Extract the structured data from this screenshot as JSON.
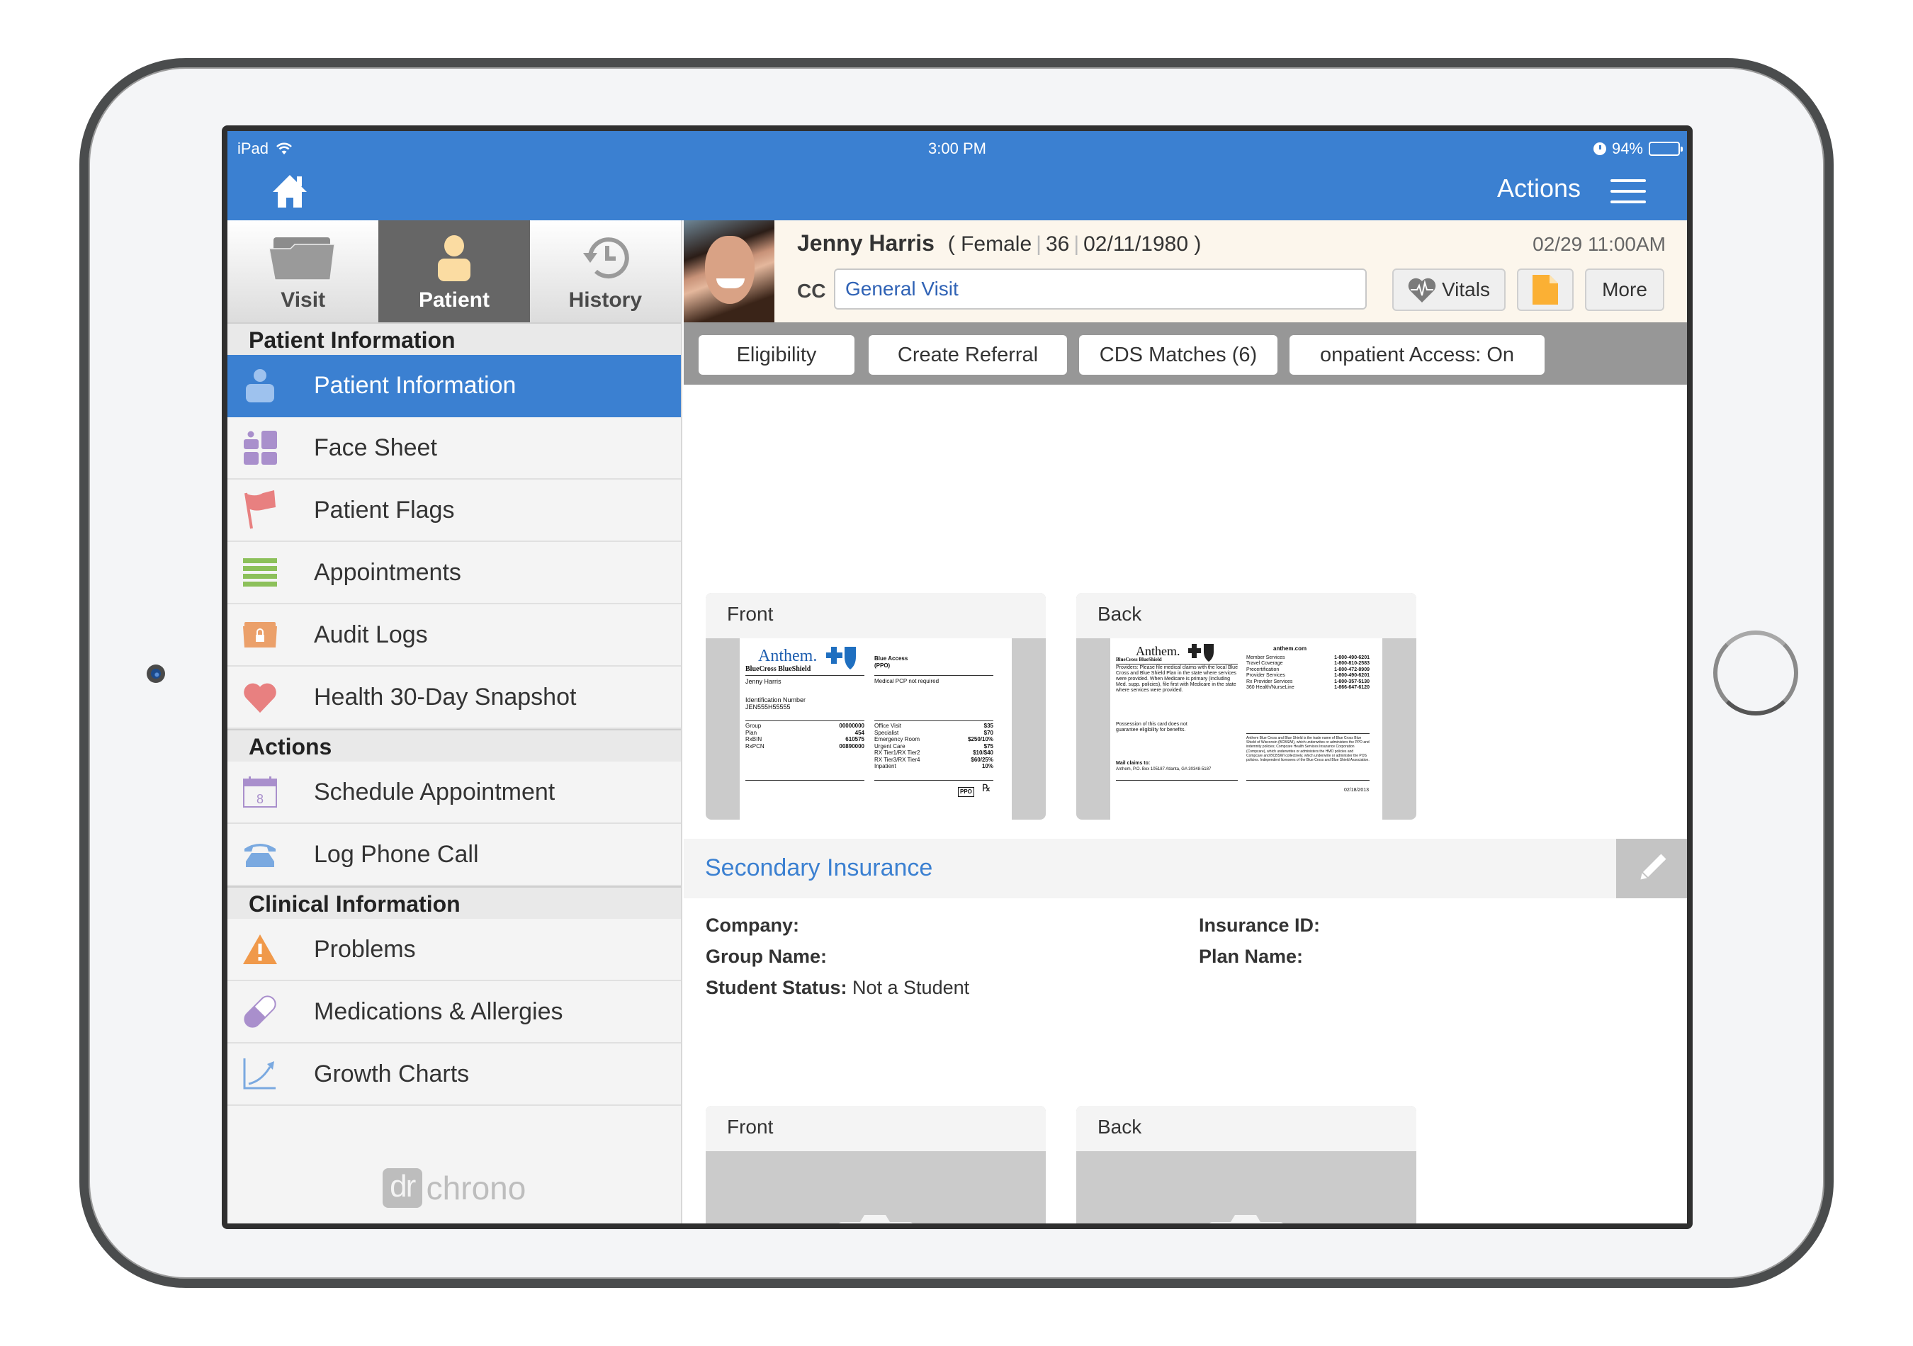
{
  "status_bar": {
    "device": "iPad",
    "time": "3:00 PM",
    "battery": "94%",
    "battery_level": 0.94
  },
  "header": {
    "actions_label": "Actions",
    "home_icon": "home-icon",
    "menu_icon": "hamburger-menu-icon"
  },
  "segments": [
    {
      "label": "Visit",
      "icon": "folder-icon",
      "active": false
    },
    {
      "label": "Patient",
      "icon": "person-icon",
      "active": true
    },
    {
      "label": "History",
      "icon": "history-clock-icon",
      "active": false
    }
  ],
  "sidebar": {
    "sections": [
      {
        "title": "Patient Information",
        "items": [
          {
            "label": "Patient Information",
            "icon": "person-icon",
            "color": "#9ec2ee",
            "active": true
          },
          {
            "label": "Face Sheet",
            "icon": "face-sheet-icon",
            "color": "#a98fcc"
          },
          {
            "label": "Patient Flags",
            "icon": "flag-icon",
            "color": "#e88080"
          },
          {
            "label": "Appointments",
            "icon": "list-icon",
            "color": "#8cc05a"
          },
          {
            "label": "Audit Logs",
            "icon": "locked-folder-icon",
            "color": "#eba06a"
          },
          {
            "label": "Health 30-Day Snapshot",
            "icon": "heart-icon",
            "color": "#e88080"
          }
        ]
      },
      {
        "title": "Actions",
        "items": [
          {
            "label": "Schedule Appointment",
            "icon": "calendar-icon",
            "color": "#a98fcc",
            "calendar_day": "8"
          },
          {
            "label": "Log Phone Call",
            "icon": "phone-icon",
            "color": "#7aa9e0"
          }
        ]
      },
      {
        "title": "Clinical Information",
        "items": [
          {
            "label": "Problems",
            "icon": "warning-icon",
            "color": "#f0994a"
          },
          {
            "label": "Medications & Allergies",
            "icon": "pill-icon",
            "color": "#a98fcc"
          },
          {
            "label": "Growth Charts",
            "icon": "growth-chart-icon",
            "color": "#7aa9e0"
          }
        ]
      }
    ],
    "logo": {
      "box": "dr",
      "text": "chrono"
    }
  },
  "patient": {
    "name": "Jenny Harris",
    "gender": "Female",
    "age": "36",
    "dob": "02/11/1980",
    "appointment_time": "02/29 11:00AM",
    "cc_label": "CC",
    "cc_value": "General Visit",
    "buttons": {
      "vitals": "Vitals",
      "more": "More"
    }
  },
  "toolbar": [
    {
      "label": "Eligibility"
    },
    {
      "label": "Create Referral"
    },
    {
      "label": "CDS Matches (6)"
    },
    {
      "label": "onpatient Access: On"
    }
  ],
  "primary_insurance_cards": {
    "front_label": "Front",
    "back_label": "Back",
    "front": {
      "brand": "Anthem.",
      "brand_sub": "BlueCross BlueShield",
      "plan_name": "Blue Access",
      "plan_type": "(PPO)",
      "member": "Jenny Harris",
      "pcp_note": "Medical PCP not required",
      "id_label": "Identification Number",
      "id_value": "JEN555H55555",
      "left_rows": [
        {
          "k": "Group",
          "v": "00000000"
        },
        {
          "k": "Plan",
          "v": "454"
        },
        {
          "k": "RxBIN",
          "v": "610575"
        },
        {
          "k": "RxPCN",
          "v": "00890000"
        }
      ],
      "right_rows": [
        {
          "k": "Office Visit",
          "v": "$35"
        },
        {
          "k": "Specialist",
          "v": "$70"
        },
        {
          "k": "Emergency Room",
          "v": "$250/10%"
        },
        {
          "k": "Urgent Care",
          "v": "$75"
        },
        {
          "k": "RX Tier1/RX Tier2",
          "v": "$10/$40"
        },
        {
          "k": "RX Tier3/RX Tier4",
          "v": "$60/25%"
        },
        {
          "k": "Inpatient",
          "v": "10%"
        }
      ],
      "badge": "PPO",
      "rx": "℞"
    },
    "back": {
      "website": "anthem.com",
      "providers_note": "Providers: Please file medical claims with the local Blue Cross and Blue Shield Plan in the state where services were provided. When Medicare is primary (including Med. supp. policies), file first with Medicare in the state where services were provided.",
      "possession_note": "Possession of this card does not guarantee eligibility for benefits.",
      "mail_label": "Mail claims to:",
      "mail_address": "Anthem, P.O. Box 105187 Atlanta, GA 30348-5187",
      "phones": [
        {
          "k": "Member Services",
          "v": "1-800-490-6201"
        },
        {
          "k": "Travel Coverage",
          "v": "1-800-810-2583"
        },
        {
          "k": "Precertification",
          "v": "1-800-472-8909"
        },
        {
          "k": "Provider Services",
          "v": "1-800-490-6201"
        },
        {
          "k": "Rx Provider Services",
          "v": "1-800-357-5130"
        },
        {
          "k": "360 Health/NurseLine",
          "v": "1-866-647-6120"
        }
      ],
      "legal": "Anthem Blue Cross and Blue Shield is the trade name of Blue Cross Blue Shield of Wisconsin (BCBSWI), which underwrites or administers the PPO and indemnity policies; Compcare Health Services Insurance Corporation (Compcare), which underwrites or administers the HMO policies and Compcare and BCBSWI collectively, which underwrite or administer the POS policies. Independent licensees of the Blue Cross and Blue Shield Association.",
      "date": "02/18/2013"
    }
  },
  "secondary_insurance": {
    "title": "Secondary Insurance",
    "fields": {
      "company_label": "Company:",
      "company_value": "",
      "insurance_id_label": "Insurance ID:",
      "insurance_id_value": "",
      "group_name_label": "Group Name:",
      "group_name_value": "",
      "plan_name_label": "Plan Name:",
      "plan_name_value": "",
      "student_status_label": "Student Status:",
      "student_status_value": "Not a Student"
    },
    "front_label": "Front",
    "back_label": "Back"
  }
}
